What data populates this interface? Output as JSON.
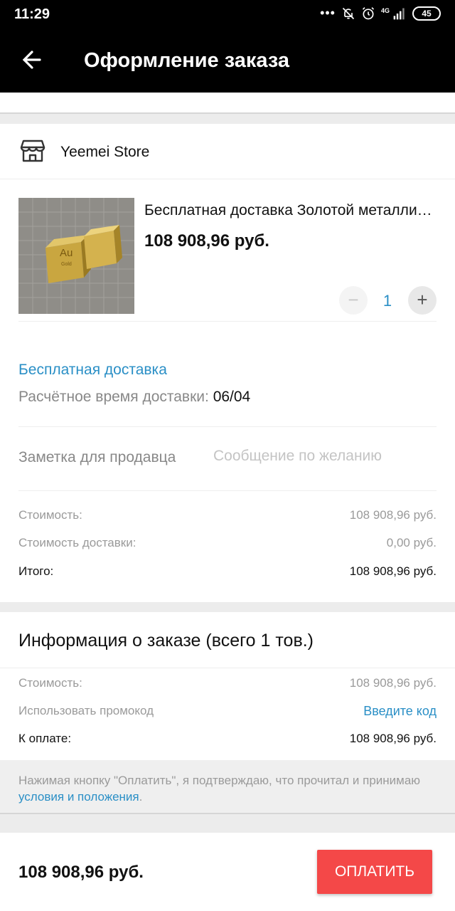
{
  "status_bar": {
    "time": "11:29",
    "network": "4G",
    "battery": "45",
    "icons": [
      "more-dots-icon",
      "bell-off-icon",
      "alarm-icon",
      "signal-icon",
      "battery-icon"
    ]
  },
  "app_bar": {
    "title": "Оформление заказа",
    "back_icon": "arrow-back-icon"
  },
  "store": {
    "name": "Yeemei Store",
    "icon": "store-icon"
  },
  "product": {
    "title": "Бесплатная доставка Золотой металлический куб",
    "price": "108 908,96 руб.",
    "image_label": "Au",
    "image_sublabel": "Gold",
    "quantity": "1",
    "minus_label": "−",
    "plus_label": "+"
  },
  "shipping": {
    "method": "Бесплатная доставка",
    "time_label": "Расчётное время доставки: ",
    "time_value": "06/04"
  },
  "seller_note": {
    "label": "Заметка для продавца",
    "placeholder": "Сообщение по желанию"
  },
  "store_summary": {
    "cost_label": "Стоимость:",
    "cost_value": "108 908,96 руб.",
    "shipping_label": "Стоимость доставки:",
    "shipping_value": "0,00 руб.",
    "total_label": "Итого:",
    "total_value": "108 908,96 руб."
  },
  "order_info": {
    "heading": "Информация о заказе (всего 1 тов.)",
    "cost_label": "Стоимость:",
    "cost_value": "108 908,96 руб.",
    "promo_label": "Использовать промокод",
    "promo_link": "Введите код",
    "pay_label": "К оплате:",
    "pay_value": "108 908,96 руб."
  },
  "terms": {
    "text_before": "Нажимая кнопку \"Оплатить\", я подтверждаю, что прочитал и принимаю ",
    "link": "условия и положения",
    "text_after": "."
  },
  "bottom_bar": {
    "total": "108 908,96 руб.",
    "pay_button": "ОПЛАТИТЬ"
  },
  "colors": {
    "accent_link": "#2a8fc6",
    "pay_button": "#f44848",
    "header_bg": "#000000"
  }
}
